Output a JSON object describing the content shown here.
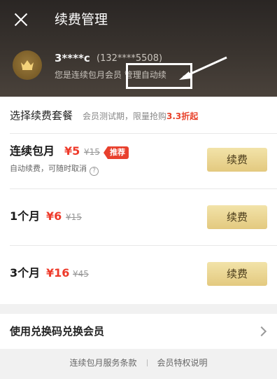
{
  "header": {
    "title": "续费管理",
    "close_icon": "close-icon"
  },
  "user": {
    "name": "3****c",
    "phone": "(132****5508)",
    "tip": "您是连续包月会员 管理自动续",
    "avatar_icon": "crown-icon"
  },
  "section": {
    "title": "选择续费套餐",
    "sub_prefix": "会员测试期，限量抢购",
    "sub_highlight": "3.3折起"
  },
  "plans": [
    {
      "name": "连续包月",
      "price": "¥5",
      "original": "¥15",
      "badge": "推荐",
      "note": "自动续费，可随时取消",
      "help_icon": "question-icon",
      "button": "续费"
    },
    {
      "name": "1个月",
      "price": "¥6",
      "original": "¥15",
      "button": "续费"
    },
    {
      "name": "3个月",
      "price": "¥16",
      "original": "¥45",
      "button": "续费"
    }
  ],
  "redeem": {
    "label": "使用兑换码兑换会员",
    "chevron_icon": "chevron-right-icon"
  },
  "footer": {
    "terms": "连续包月服务条款",
    "privileges": "会员特权说明"
  },
  "colors": {
    "header_bg": "#2a2624",
    "price_red": "#ee3a2a",
    "button_gold": "#e3c97f",
    "badge_red": "#e8402d",
    "annotation": "#ffffff"
  }
}
